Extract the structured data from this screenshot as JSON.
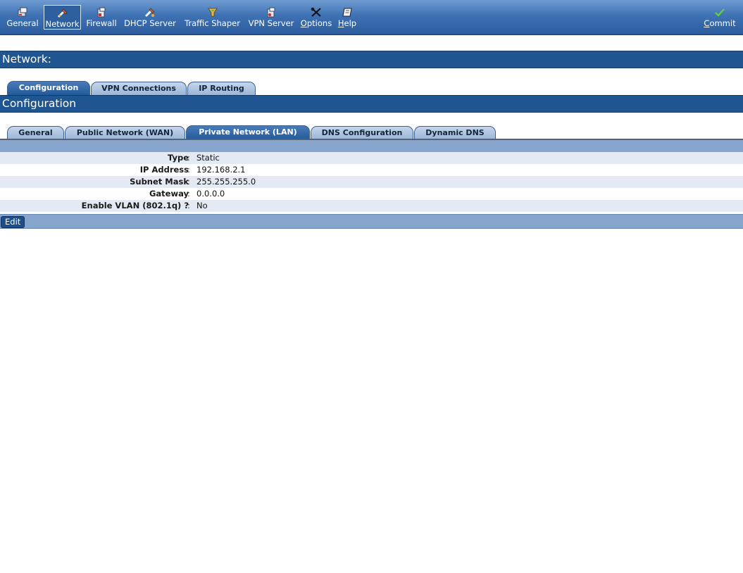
{
  "toolbar": {
    "items": [
      {
        "label": "General",
        "icon": "general-icon"
      },
      {
        "label": "Network",
        "icon": "network-icon",
        "active": true
      },
      {
        "label": "Firewall",
        "icon": "firewall-icon"
      },
      {
        "label": "DHCP Server",
        "icon": "dhcp-server-icon"
      },
      {
        "label": "Traffic Shaper",
        "icon": "traffic-shaper-icon"
      },
      {
        "label": "VPN Server",
        "icon": "vpn-server-icon"
      },
      {
        "label": "Options",
        "icon": "options-icon"
      },
      {
        "label": "Help",
        "icon": "help-icon"
      }
    ],
    "commit": {
      "label": "Commit",
      "icon": "checkmark-icon"
    }
  },
  "page_title": "Network:",
  "top_tabs": [
    {
      "label": "Configuration",
      "selected": true
    },
    {
      "label": "VPN Connections"
    },
    {
      "label": "IP Routing"
    }
  ],
  "section_title": "Configuration",
  "sub_tabs": [
    {
      "label": "General"
    },
    {
      "label": "Public Network (WAN)"
    },
    {
      "label": "Private Network (LAN)",
      "selected": true
    },
    {
      "label": "DNS Configuration"
    },
    {
      "label": "Dynamic DNS"
    }
  ],
  "fields": [
    {
      "label": "Type",
      "value": "Static"
    },
    {
      "label": "IP Address",
      "value": "192.168.2.1"
    },
    {
      "label": "Subnet Mask",
      "value": "255.255.255.0"
    },
    {
      "label": "Gateway",
      "value": "0.0.0.0"
    },
    {
      "label": "Enable VLAN (802.1q) ?",
      "value": "No"
    }
  ],
  "edit_label": "Edit",
  "colors": {
    "toolbar": "#3f72b4",
    "section_bar": "#1f5591",
    "tab_selected": "#225a9a",
    "tab_normal": "#9bb5d6",
    "table_band": "#87a4cc",
    "row_alt": "#e4eaf3"
  }
}
